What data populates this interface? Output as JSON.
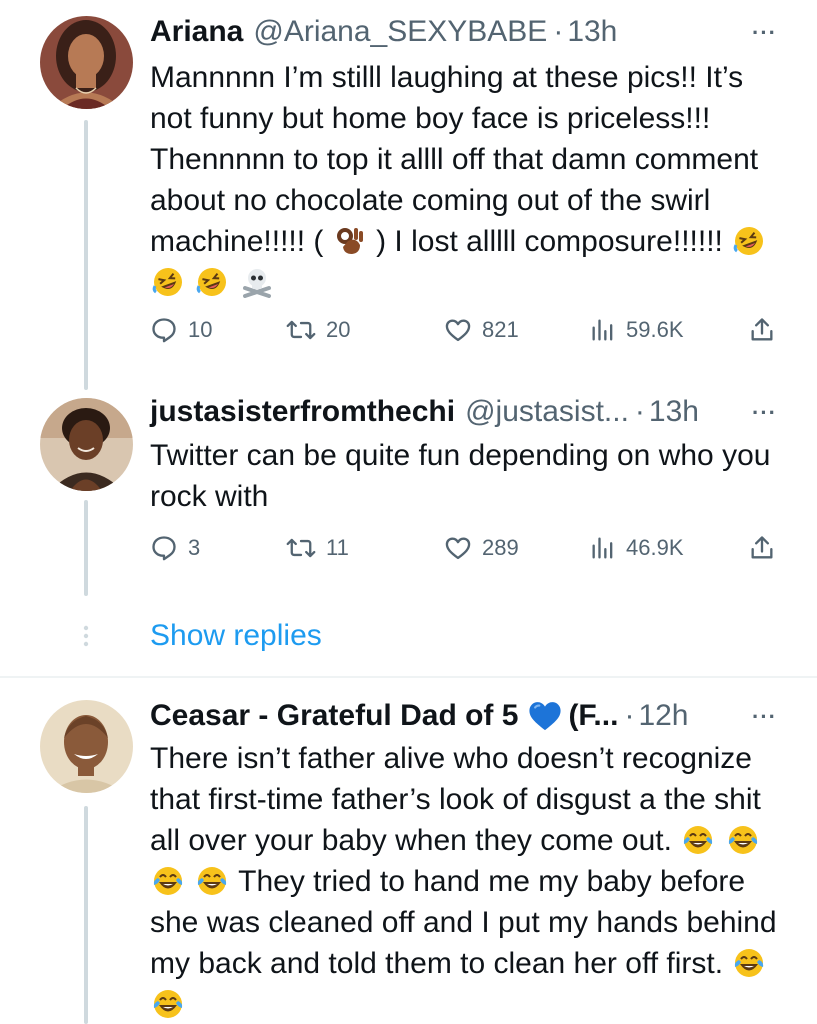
{
  "tweets": [
    {
      "name": "Ariana",
      "name_extra": "",
      "handle": "@Ariana_SEXYBABE",
      "separator": "·",
      "time": "13h",
      "more": "···",
      "text_parts": {
        "p1": "Mannnnn I’m stilll laughing at these pics!! It’s not funny but home boy face is priceless!!! Thennnnn to top it allll off that damn comment about no chocolate coming out of the swirl machine!!!!! (",
        "p2": ") I lost alllll composure!!!!!!"
      },
      "emojis": [
        "ok-hand-dark-emoji",
        "rofl-emoji",
        "rofl-emoji",
        "rofl-emoji",
        "skull-crossbones-emoji"
      ],
      "actions": {
        "replies": "10",
        "retweets": "20",
        "likes": "821",
        "views": "59.6K"
      }
    },
    {
      "name": "justasisterfromthechi",
      "handle": "@justasist...",
      "separator": "·",
      "time": "13h",
      "more": "···",
      "text": "Twitter can be quite fun depending on who you rock with",
      "actions": {
        "replies": "3",
        "retweets": "11",
        "likes": "289",
        "views": "46.9K"
      }
    },
    {
      "name": "Ceasar - Grateful Dad of 5",
      "name_extra": "(F...",
      "handle": "",
      "separator": "·",
      "time": "12h",
      "more": "···",
      "text_parts": {
        "p1": "There isn’t father alive who doesn’t recognize that first-time father’s look of disgust a the shit all over your baby when they come out.",
        "p2": "They tried to hand me my baby before she was cleaned off and I put my hands behind my back and told them to clean her off first."
      },
      "emojis": [
        "blue-heart-emoji",
        "tears-of-joy-emoji"
      ]
    }
  ],
  "show_replies": "Show replies",
  "colors": {
    "text": "#0f1419",
    "secondary": "#536471",
    "link": "#1d9bf0",
    "thread_line": "#cfd9de",
    "divider": "#eff3f4"
  }
}
